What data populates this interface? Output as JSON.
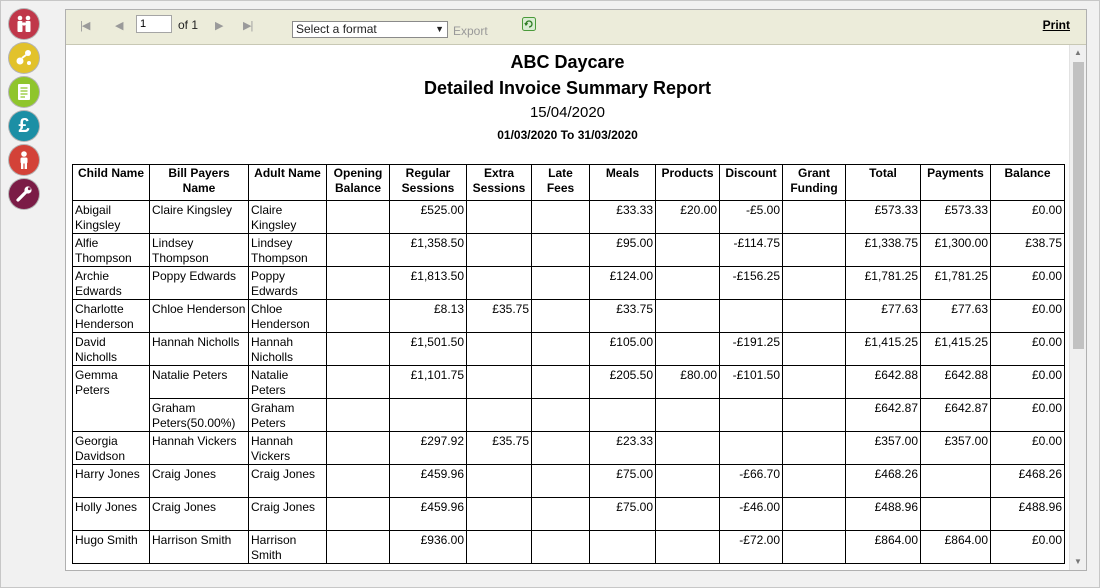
{
  "sidebar": {
    "icons": [
      {
        "name": "family-icon",
        "color": "#c0374a"
      },
      {
        "name": "org-chart-icon",
        "color": "#e2c22b"
      },
      {
        "name": "document-icon",
        "color": "#8fc52c"
      },
      {
        "name": "pound-icon",
        "color": "#1c8fa5",
        "glyph": "£"
      },
      {
        "name": "child-icon",
        "color": "#d34238"
      },
      {
        "name": "tools-icon",
        "color": "#7b1c46"
      }
    ]
  },
  "toolbar": {
    "page_current": "1",
    "page_of": "of 1",
    "format_select": "Select a format",
    "export_label": "Export",
    "print_label": "Print"
  },
  "report": {
    "company": "ABC Daycare",
    "title": "Detailed Invoice Summary Report",
    "date": "15/04/2020",
    "period": "01/03/2020 To 31/03/2020",
    "columns": [
      "Child Name",
      "Bill Payers Name",
      "Adult Name",
      "Opening Balance",
      "Regular Sessions",
      "Extra Sessions",
      "Late Fees",
      "Meals",
      "Products",
      "Discount",
      "Grant Funding",
      "Total",
      "Payments",
      "Balance"
    ],
    "rows": [
      {
        "child": "Abigail Kingsley",
        "payer": "Claire Kingsley",
        "adult": "Claire Kingsley",
        "opening": "",
        "regular": "£525.00",
        "extra": "",
        "late": "",
        "meals": "£33.33",
        "products": "£20.00",
        "discount": "-£5.00",
        "grant": "",
        "total": "£573.33",
        "payments": "£573.33",
        "balance": "£0.00"
      },
      {
        "child": "Alfie Thompson",
        "payer": "Lindsey Thompson",
        "adult": "Lindsey Thompson",
        "opening": "",
        "regular": "£1,358.50",
        "extra": "",
        "late": "",
        "meals": "£95.00",
        "products": "",
        "discount": "-£114.75",
        "grant": "",
        "total": "£1,338.75",
        "payments": "£1,300.00",
        "balance": "£38.75"
      },
      {
        "child": "Archie Edwards",
        "payer": "Poppy Edwards",
        "adult": "Poppy Edwards",
        "opening": "",
        "regular": "£1,813.50",
        "extra": "",
        "late": "",
        "meals": "£124.00",
        "products": "",
        "discount": "-£156.25",
        "grant": "",
        "total": "£1,781.25",
        "payments": "£1,781.25",
        "balance": "£0.00"
      },
      {
        "child": "Charlotte Henderson",
        "payer": "Chloe Henderson",
        "adult": "Chloe Henderson",
        "opening": "",
        "regular": "£8.13",
        "extra": "£35.75",
        "late": "",
        "meals": "£33.75",
        "products": "",
        "discount": "",
        "grant": "",
        "total": "£77.63",
        "payments": "£77.63",
        "balance": "£0.00"
      },
      {
        "child": "David Nicholls",
        "payer": "Hannah Nicholls",
        "adult": "Hannah Nicholls",
        "opening": "",
        "regular": "£1,501.50",
        "extra": "",
        "late": "",
        "meals": "£105.00",
        "products": "",
        "discount": "-£191.25",
        "grant": "",
        "total": "£1,415.25",
        "payments": "£1,415.25",
        "balance": "£0.00"
      },
      {
        "child": "Gemma Peters",
        "payer": "Natalie Peters",
        "adult": "Natalie Peters",
        "opening": "",
        "regular": "£1,101.75",
        "extra": "",
        "late": "",
        "meals": "£205.50",
        "products": "£80.00",
        "discount": "-£101.50",
        "grant": "",
        "total": "£642.88",
        "payments": "£642.88",
        "balance": "£0.00"
      },
      {
        "child": "",
        "payer": "Graham Peters(50.00%)",
        "adult": "Graham Peters",
        "opening": "",
        "regular": "",
        "extra": "",
        "late": "",
        "meals": "",
        "products": "",
        "discount": "",
        "grant": "",
        "total": "£642.87",
        "payments": "£642.87",
        "balance": "£0.00"
      },
      {
        "child": "Georgia Davidson",
        "payer": "Hannah Vickers",
        "adult": "Hannah Vickers",
        "opening": "",
        "regular": "£297.92",
        "extra": "£35.75",
        "late": "",
        "meals": "£23.33",
        "products": "",
        "discount": "",
        "grant": "",
        "total": "£357.00",
        "payments": "£357.00",
        "balance": "£0.00"
      },
      {
        "child": "Harry Jones",
        "payer": "Craig Jones",
        "adult": "Craig Jones",
        "opening": "",
        "regular": "£459.96",
        "extra": "",
        "late": "",
        "meals": "£75.00",
        "products": "",
        "discount": "-£66.70",
        "grant": "",
        "total": "£468.26",
        "payments": "",
        "balance": "£468.26"
      },
      {
        "child": "Holly Jones",
        "payer": "Craig Jones",
        "adult": "Craig Jones",
        "opening": "",
        "regular": "£459.96",
        "extra": "",
        "late": "",
        "meals": "£75.00",
        "products": "",
        "discount": "-£46.00",
        "grant": "",
        "total": "£488.96",
        "payments": "",
        "balance": "£488.96"
      },
      {
        "child": "Hugo Smith",
        "payer": "Harrison Smith",
        "adult": "Harrison Smith",
        "opening": "",
        "regular": "£936.00",
        "extra": "",
        "late": "",
        "meals": "",
        "products": "",
        "discount": "-£72.00",
        "grant": "",
        "total": "£864.00",
        "payments": "£864.00",
        "balance": "£0.00"
      }
    ]
  }
}
